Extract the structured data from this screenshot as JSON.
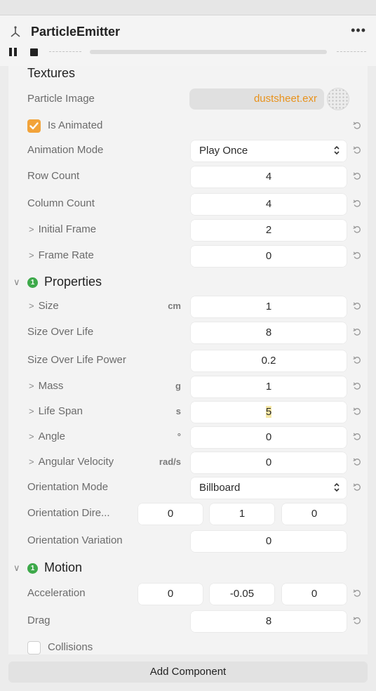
{
  "header": {
    "title": "ParticleEmitter",
    "more_label": "•••"
  },
  "textures": {
    "section_title": "Textures",
    "particle_image_label": "Particle Image",
    "particle_image_value": "dustsheet.exr",
    "is_animated_label": "Is Animated",
    "is_animated": true,
    "animation_mode_label": "Animation Mode",
    "animation_mode_value": "Play Once",
    "row_count_label": "Row Count",
    "row_count_value": "4",
    "column_count_label": "Column Count",
    "column_count_value": "4",
    "initial_frame_label": "Initial Frame",
    "initial_frame_value": "2",
    "frame_rate_label": "Frame Rate",
    "frame_rate_value": "0"
  },
  "properties": {
    "section_title": "Properties",
    "badge": "1",
    "size_label": "Size",
    "size_unit": "cm",
    "size_value": "1",
    "size_over_life_label": "Size Over Life",
    "size_over_life_value": "8",
    "size_over_life_power_label": "Size Over Life Power",
    "size_over_life_power_value": "0.2",
    "mass_label": "Mass",
    "mass_unit": "g",
    "mass_value": "1",
    "life_span_label": "Life Span",
    "life_span_unit": "s",
    "life_span_value": "5",
    "angle_label": "Angle",
    "angle_unit": "°",
    "angle_value": "0",
    "angular_velocity_label": "Angular Velocity",
    "angular_velocity_unit": "rad/s",
    "angular_velocity_value": "0",
    "orientation_mode_label": "Orientation Mode",
    "orientation_mode_value": "Billboard",
    "orientation_direction_label": "Orientation Dire...",
    "orientation_direction_values": [
      "0",
      "1",
      "0"
    ],
    "orientation_variation_label": "Orientation Variation",
    "orientation_variation_value": "0"
  },
  "motion": {
    "section_title": "Motion",
    "badge": "1",
    "acceleration_label": "Acceleration",
    "acceleration_values": [
      "0",
      "-0.05",
      "0"
    ],
    "drag_label": "Drag",
    "drag_value": "8",
    "collisions_label": "Collisions",
    "collisions": false
  },
  "footer": {
    "add_component_label": "Add Component"
  },
  "colors": {
    "accent_orange": "#f2a33a",
    "file_text": "#e8921c",
    "badge_green": "#3da94a"
  }
}
